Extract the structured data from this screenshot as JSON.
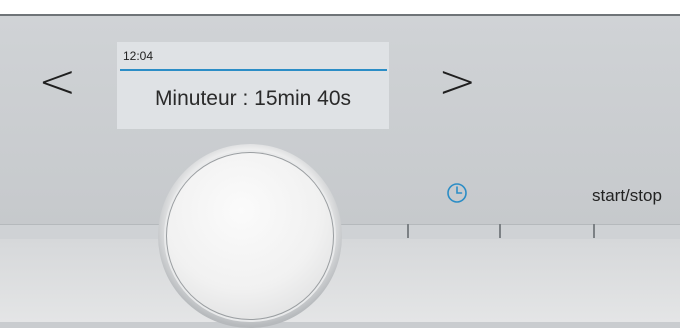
{
  "navigation": {
    "prev_symbol": "<",
    "next_symbol": ">"
  },
  "display": {
    "time": "12:04",
    "timer_text": "Minuteur : 15min 40s",
    "accent_color": "#2b8dc6"
  },
  "controls": {
    "timer_icon": "clock-icon",
    "start_stop_label": "start/stop"
  },
  "knob": {
    "icon": "rotary-knob"
  }
}
